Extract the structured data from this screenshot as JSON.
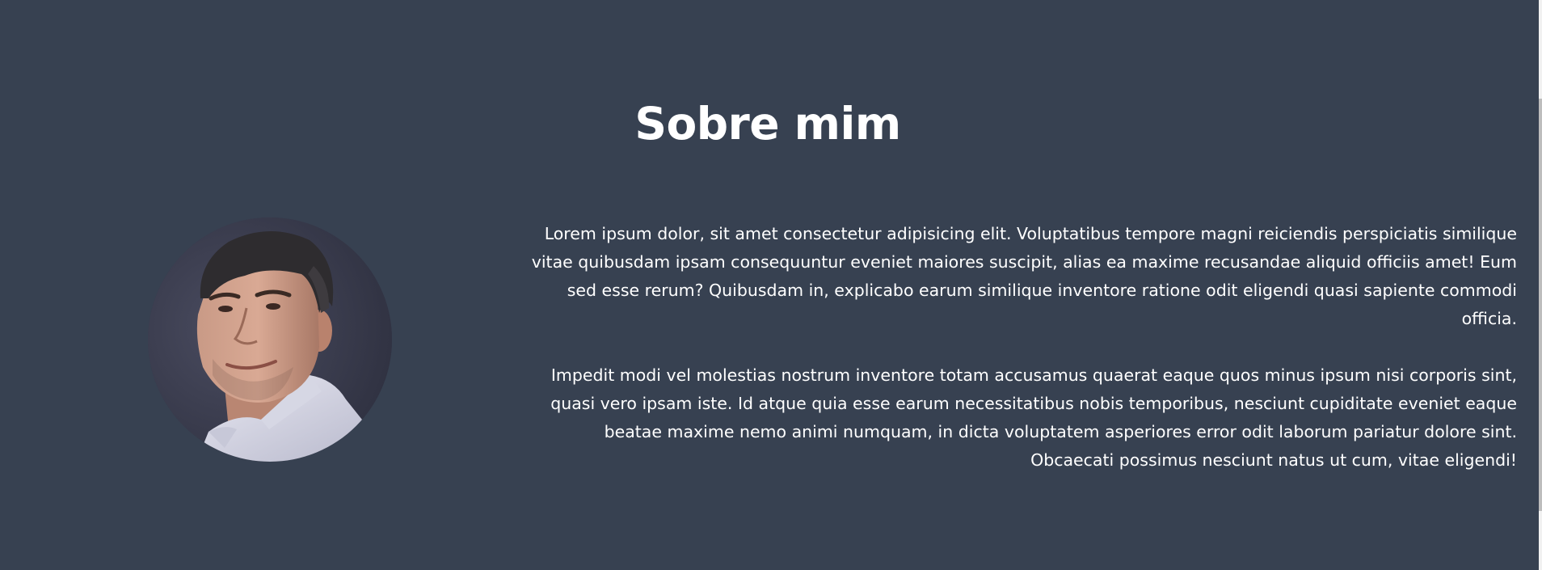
{
  "about": {
    "title": "Sobre mim",
    "paragraphs": [
      "Lorem ipsum dolor, sit amet consectetur adipisicing elit. Voluptatibus tempore magni reiciendis perspiciatis similique vitae quibusdam ipsam consequuntur eveniet maiores suscipit, alias ea maxime recusandae aliquid officiis amet! Eum sed esse rerum? Quibusdam in, explicabo earum similique inventore ratione odit eligendi quasi sapiente commodi officia.",
      "Impedit modi vel molestias nostrum inventore totam accusamus quaerat eaque quos minus ipsum nisi corporis sint, quasi vero ipsam iste. Id atque quia esse earum necessitatibus nobis temporibus, nesciunt cupiditate eveniet eaque beatae maxime nemo animi numquam, in dicta voluptatem asperiores error odit laborum pariatur dolore sint. Obcaecati possimus nesciunt natus ut cum, vitae eligendi!"
    ]
  },
  "colors": {
    "background": "#374151",
    "text": "#ffffff"
  }
}
